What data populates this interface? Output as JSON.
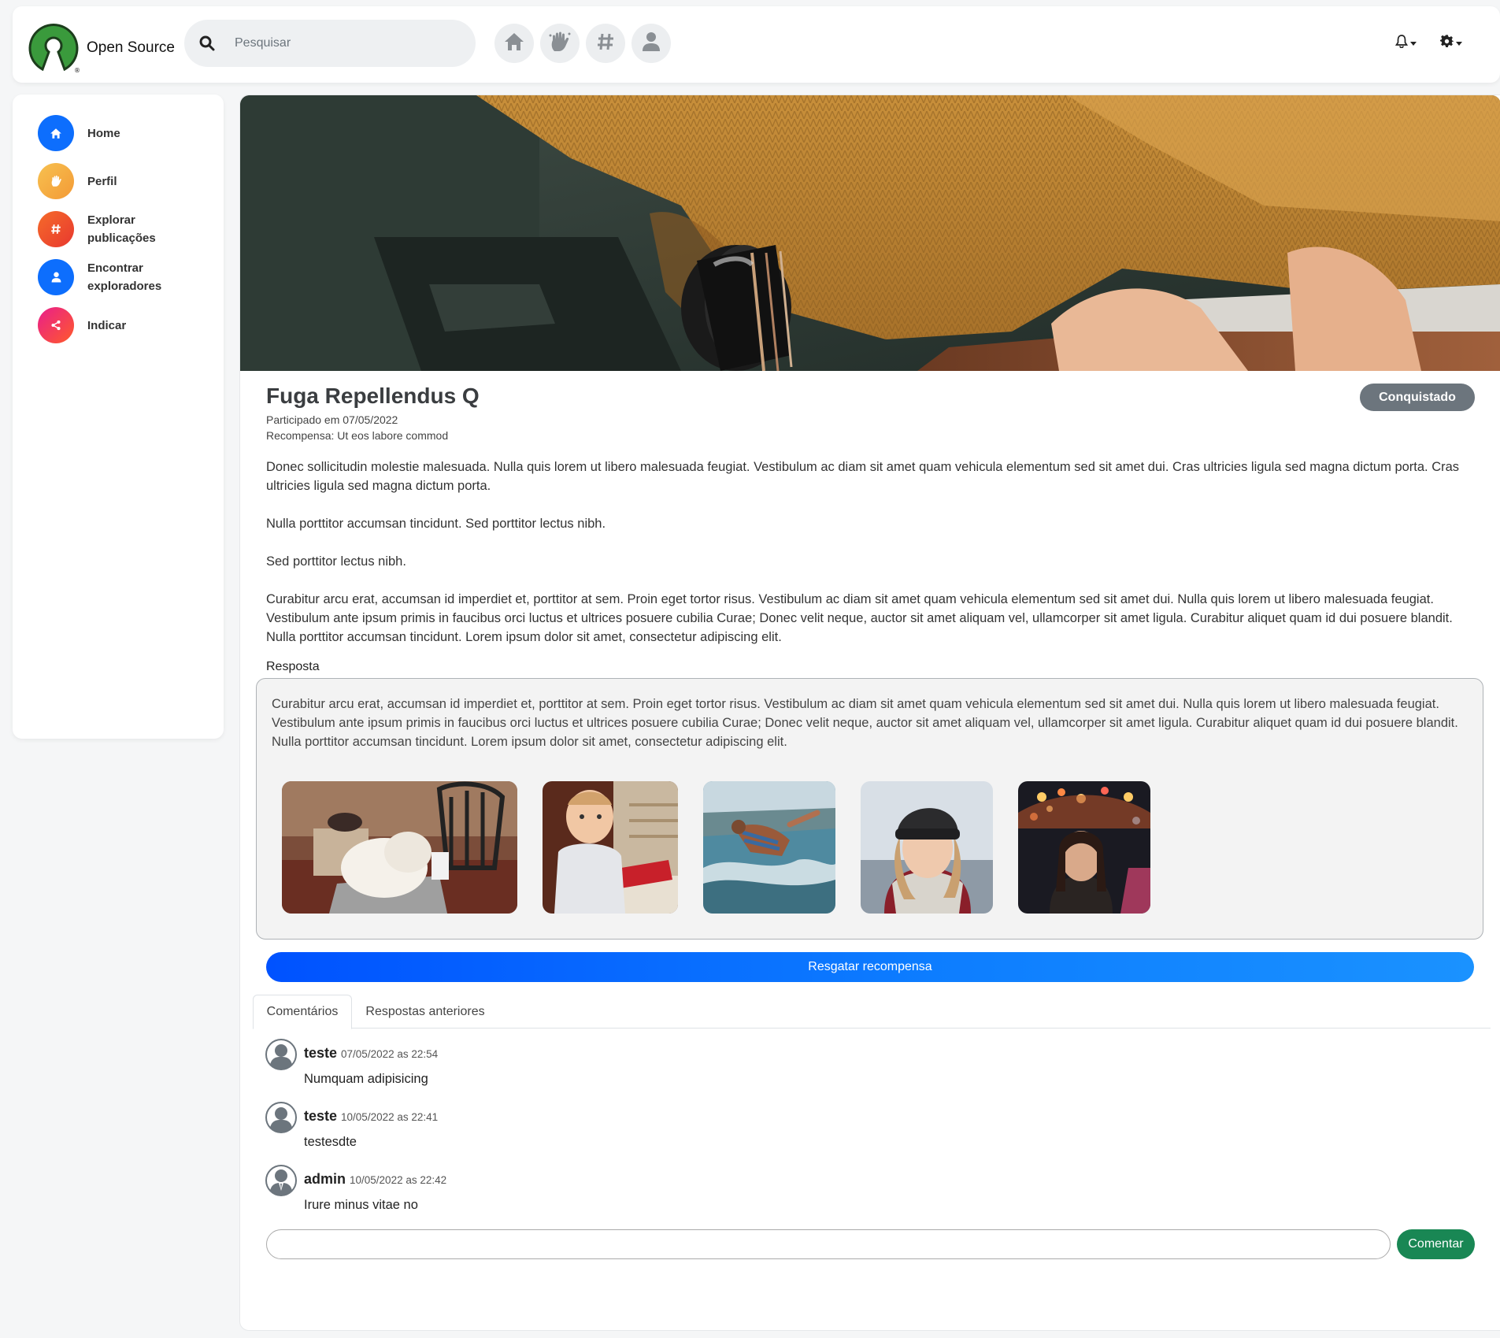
{
  "brand": {
    "name": "Open Source"
  },
  "search": {
    "placeholder": "Pesquisar"
  },
  "topnav": [
    {
      "icon": "home-icon"
    },
    {
      "icon": "hand-icon"
    },
    {
      "icon": "hashtag-icon"
    },
    {
      "icon": "user-icon"
    }
  ],
  "sidebar": {
    "items": [
      {
        "label": "Home",
        "icon": "home-icon",
        "color": "#0d6efd"
      },
      {
        "label": "Perfil",
        "icon": "hand-icon",
        "color": "#f5a742"
      },
      {
        "label": "Explorar publicações",
        "icon": "hashtag-icon",
        "color": "#f0562e"
      },
      {
        "label": "Encontrar exploradores",
        "icon": "user-icon",
        "color": "#0d6efd"
      },
      {
        "label": "Indicar",
        "icon": "share-icon",
        "color": "#ff2a6d"
      }
    ]
  },
  "challenge": {
    "title": "Fuga Repellendus Q",
    "participated": "Participado em 07/05/2022",
    "reward": "Recompensa: Ut eos labore commod",
    "status": "Conquistado",
    "paragraphs": [
      "Donec sollicitudin molestie malesuada. Nulla quis lorem ut libero malesuada feugiat. Vestibulum ac diam sit amet quam vehicula elementum sed sit amet dui. Cras ultricies ligula sed magna dictum porta. Cras ultricies ligula sed magna dictum porta.",
      "Nulla porttitor accumsan tincidunt. Sed porttitor lectus nibh.",
      "Sed porttitor lectus nibh.",
      "Curabitur arcu erat, accumsan id imperdiet et, porttitor at sem. Proin eget tortor risus. Vestibulum ac diam sit amet quam vehicula elementum sed sit amet dui. Nulla quis lorem ut libero malesuada feugiat. Vestibulum ante ipsum primis in faucibus orci luctus et ultrices posuere cubilia Curae; Donec velit neque, auctor sit amet aliquam vel, ullamcorper sit amet ligula. Curabitur aliquet quam id dui posuere blandit. Nulla porttitor accumsan tincidunt. Lorem ipsum dolor sit amet, consectetur adipiscing elit."
    ]
  },
  "response": {
    "label": "Resposta",
    "text": "Curabitur arcu erat, accumsan id imperdiet et, porttitor at sem. Proin eget tortor risus. Vestibulum ac diam sit amet quam vehicula elementum sed sit amet dui. Nulla quis lorem ut libero malesuada feugiat. Vestibulum ante ipsum primis in faucibus orci luctus et ultrices posuere cubilia Curae; Donec velit neque, auctor sit amet aliquam vel, ullamcorper sit amet ligula. Curabitur aliquet quam id dui posuere blandit. Nulla porttitor accumsan tincidunt. Lorem ipsum dolor sit amet, consectetur adipiscing elit."
  },
  "redeem_button": "Resgatar recompensa",
  "tabs": [
    {
      "label": "Comentários",
      "active": true
    },
    {
      "label": "Respostas anteriores",
      "active": false
    }
  ],
  "comments": [
    {
      "author": "teste",
      "time": "07/05/2022 as 22:54",
      "text": "Numquam adipisicing"
    },
    {
      "author": "teste",
      "time": "10/05/2022 as 22:41",
      "text": "testesdte"
    },
    {
      "author": "admin",
      "time": "10/05/2022 as 22:42",
      "text": "Irure minus vitae no"
    }
  ],
  "comment_form": {
    "placeholder": "",
    "button": "Comentar"
  },
  "colors": {
    "accent": "#0d6efd",
    "success": "#198754",
    "badge": "#6c757d"
  }
}
